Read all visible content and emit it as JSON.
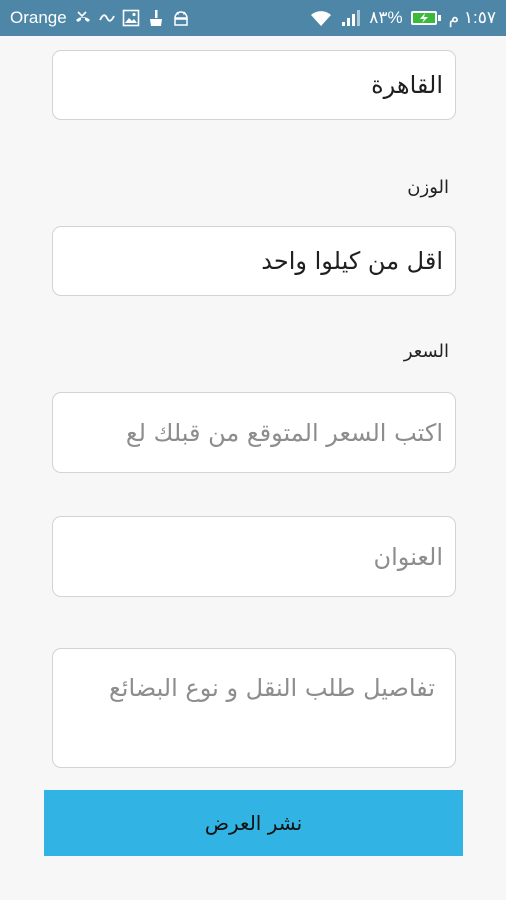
{
  "status_bar": {
    "carrier": "Orange",
    "battery_percent": "٨٣%",
    "time": "١:٥٧ م",
    "icons": [
      "missed-call-icon",
      "voicemail-icon",
      "image-icon",
      "cleaner-icon",
      "android-icon",
      "wifi-icon",
      "signal-icon",
      "battery-charging-icon"
    ]
  },
  "form": {
    "city_value": "القاهرة",
    "weight_label": "الوزن",
    "weight_value": "اقل من كيلوا واحد",
    "price_label": "السعر",
    "price_placeholder": "اكتب السعر المتوقع من قبلك لع",
    "address_placeholder": "العنوان",
    "details_placeholder": "تفاصيل طلب النقل و نوع البضائع",
    "submit_label": "نشر العرض"
  },
  "colors": {
    "status_bar": "#4d86a7",
    "submit_button": "#31b4e3",
    "background": "#f7f7f7"
  }
}
